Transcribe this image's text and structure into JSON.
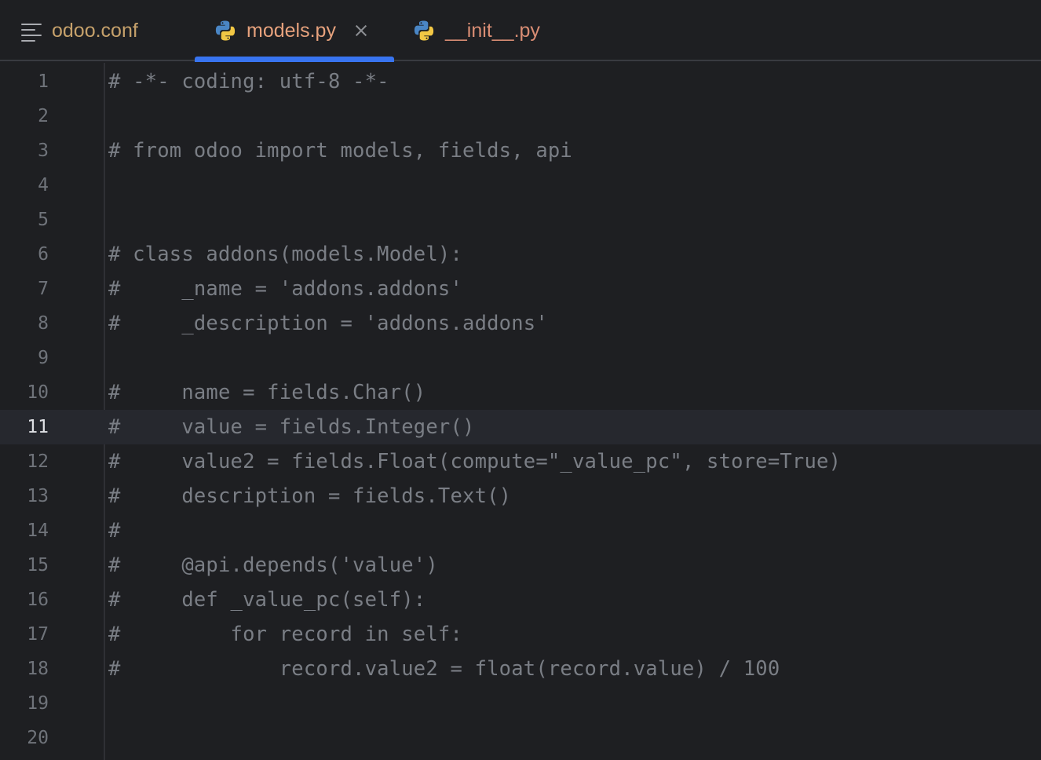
{
  "tabs": [
    {
      "label": "odoo.conf",
      "icon": "menu-icon"
    },
    {
      "label": "models.py",
      "icon": "python-icon",
      "active": true
    },
    {
      "label": "__init__.py",
      "icon": "python-icon"
    }
  ],
  "editor": {
    "current_line": 11,
    "lines": [
      {
        "no": "1",
        "text": "# -*- coding: utf-8 -*-"
      },
      {
        "no": "2",
        "text": ""
      },
      {
        "no": "3",
        "text": "# from odoo import models, fields, api"
      },
      {
        "no": "4",
        "text": ""
      },
      {
        "no": "5",
        "text": ""
      },
      {
        "no": "6",
        "text": "# class addons(models.Model):"
      },
      {
        "no": "7",
        "text": "#     _name = 'addons.addons'"
      },
      {
        "no": "8",
        "text": "#     _description = 'addons.addons'"
      },
      {
        "no": "9",
        "text": ""
      },
      {
        "no": "10",
        "text": "#     name = fields.Char()"
      },
      {
        "no": "11",
        "text": "#     value = fields.Integer()"
      },
      {
        "no": "12",
        "text": "#     value2 = fields.Float(compute=\"_value_pc\", store=True)"
      },
      {
        "no": "13",
        "text": "#     description = fields.Text()"
      },
      {
        "no": "14",
        "text": "#"
      },
      {
        "no": "15",
        "text": "#     @api.depends('value')"
      },
      {
        "no": "16",
        "text": "#     def _value_pc(self):"
      },
      {
        "no": "17",
        "text": "#         for record in self:"
      },
      {
        "no": "18",
        "text": "#             record.value2 = float(record.value) / 100"
      },
      {
        "no": "19",
        "text": ""
      },
      {
        "no": "20",
        "text": ""
      }
    ]
  },
  "colors": {
    "background": "#1e1f22",
    "accent": "#3874f0",
    "comment": "#7a7e85"
  }
}
